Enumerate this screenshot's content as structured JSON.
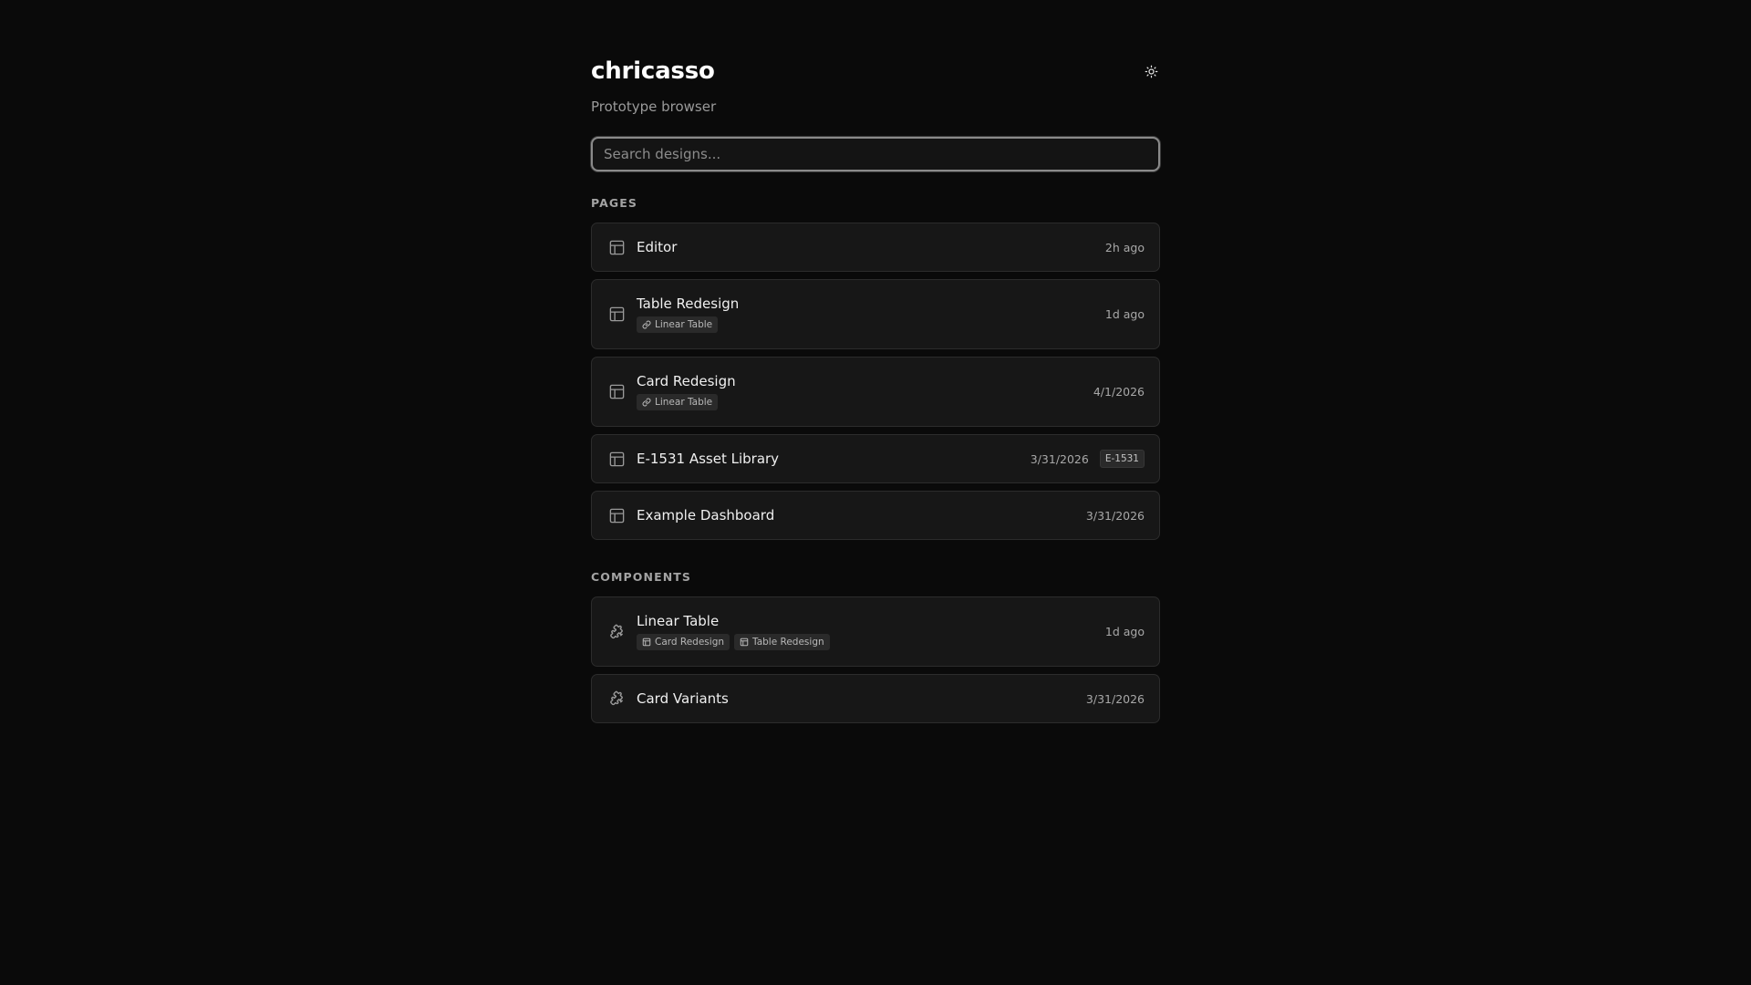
{
  "header": {
    "title": "chricasso",
    "subtitle": "Prototype browser",
    "theme_toggle_icon": "sun-icon"
  },
  "search": {
    "placeholder": "Search designs...",
    "value": ""
  },
  "pages": {
    "label": "PAGES",
    "items": [
      {
        "name": "Editor",
        "date": "2h ago",
        "icon": "layout-icon"
      },
      {
        "name": "Table Redesign",
        "date": "1d ago",
        "icon": "layout-icon",
        "tags": [
          {
            "label": "Linear Table",
            "icon": "link-icon"
          }
        ]
      },
      {
        "name": "Card Redesign",
        "date": "4/1/2026",
        "icon": "layout-icon",
        "tags": [
          {
            "label": "Linear Table",
            "icon": "link-icon"
          }
        ]
      },
      {
        "name": "E-1531 Asset Library",
        "date": "3/31/2026",
        "badge": "E-1531",
        "icon": "layout-icon"
      },
      {
        "name": "Example Dashboard",
        "date": "3/31/2026",
        "icon": "layout-icon"
      }
    ]
  },
  "components": {
    "label": "COMPONENTS",
    "items": [
      {
        "name": "Linear Table",
        "date": "1d ago",
        "icon": "puzzle-icon",
        "tags": [
          {
            "label": "Card Redesign",
            "icon": "layout-icon"
          },
          {
            "label": "Table Redesign",
            "icon": "layout-icon"
          }
        ]
      },
      {
        "name": "Card Variants",
        "date": "3/31/2026",
        "icon": "puzzle-icon"
      }
    ]
  },
  "colors": {
    "background": "#0a0a0a",
    "card": "#171717",
    "border": "#2c2c2c",
    "text": "#ededed",
    "muted": "#a3a3a3"
  }
}
